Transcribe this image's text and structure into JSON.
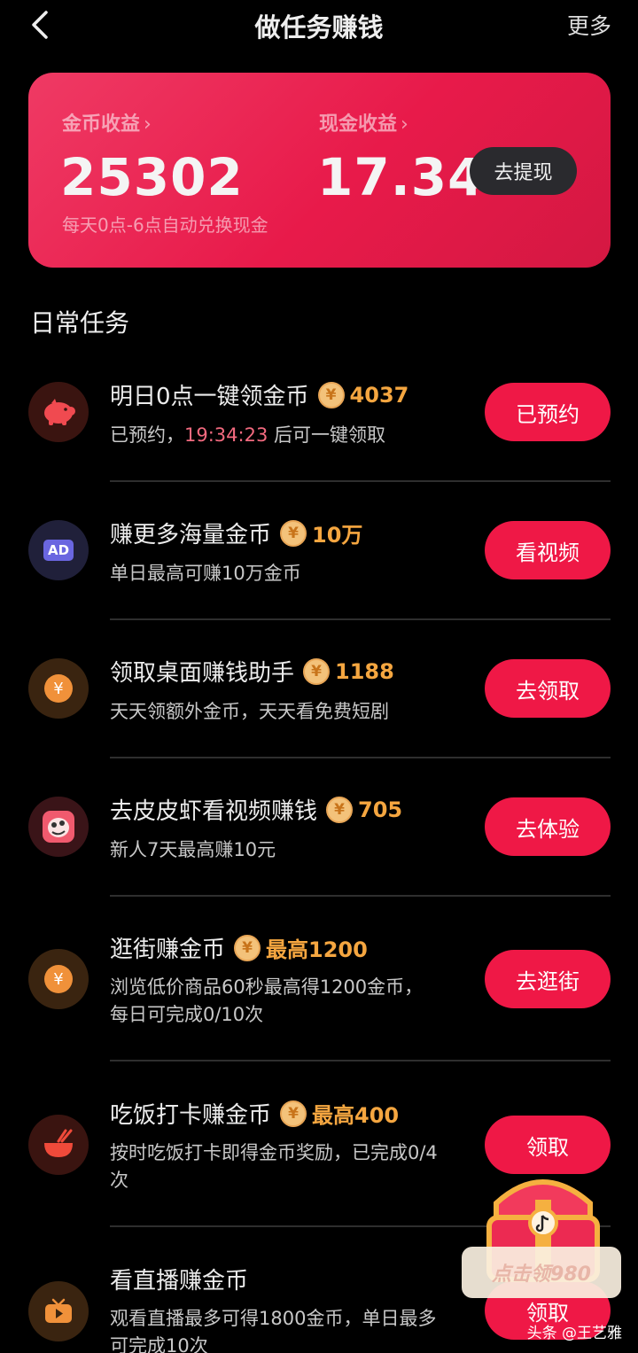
{
  "nav": {
    "title": "做任务赚钱",
    "more": "更多"
  },
  "earnings": {
    "coin_label": "金币收益",
    "coin_value": "25302",
    "cash_label": "现金收益",
    "cash_value": "17.34",
    "chevron": "›",
    "note": "每天0点-6点自动兑换现金",
    "withdraw_button": "去提现"
  },
  "section_title": "日常任务",
  "coin_symbol": "¥",
  "tasks": [
    {
      "title": "明日0点一键领金币",
      "reward": "4037",
      "desc_pre": "已预约，",
      "desc_time": "19:34:23",
      "desc_post": " 后可一键领取",
      "button": "已预约",
      "icon": "piggy-bank-icon"
    },
    {
      "title": "赚更多海量金币",
      "reward": "10万",
      "desc": "单日最高可赚10万金币",
      "button": "看视频",
      "icon": "ad-icon",
      "icon_text": "AD"
    },
    {
      "title": "领取桌面赚钱助手",
      "reward": "1188",
      "desc": "天天领额外金币，天天看免费短剧",
      "button": "去领取",
      "icon": "coin-icon"
    },
    {
      "title": "去皮皮虾看视频赚钱",
      "reward": "705",
      "desc": "新人7天最高赚10元",
      "button": "去体验",
      "icon": "pipixia-app-icon"
    },
    {
      "title": "逛街赚金币",
      "reward": "最高1200",
      "desc": "浏览低价商品60秒最高得1200金币，每日可完成0/10次",
      "button": "去逛街",
      "icon": "coin-icon"
    },
    {
      "title": "吃饭打卡赚金币",
      "reward": "最高400",
      "desc": "按时吃饭打卡即得金币奖励，已完成0/4次",
      "button": "领取",
      "icon": "rice-bowl-icon"
    },
    {
      "title": "看直播赚金币",
      "desc": "观看直播最多可得1800金币，单日最多可完成10次",
      "button": "领取",
      "icon": "live-tv-icon"
    }
  ],
  "chest": {
    "label": "点击领980"
  },
  "watermark": "头条 @王艺雅",
  "colors": {
    "accent": "#ef1846",
    "reward": "#f5a640",
    "card": "#e81a4a",
    "time": "#f26a7f"
  }
}
